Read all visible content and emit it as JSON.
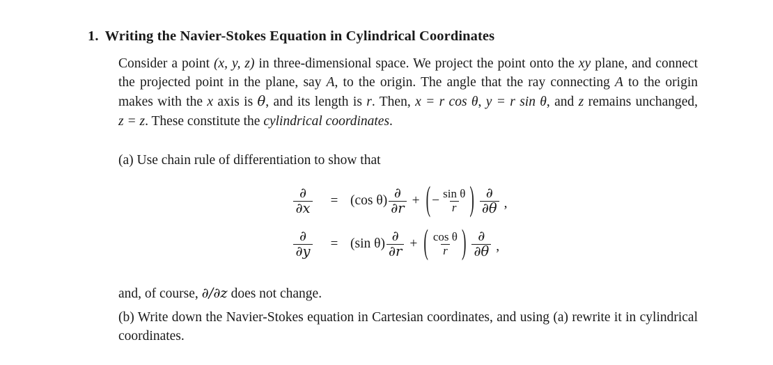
{
  "document": {
    "background_color": "#ffffff",
    "text_color": "#1a1a1a",
    "problem": {
      "number": "1.",
      "title": "Writing the Navier-Stokes Equation in Cylindrical Coordinates"
    },
    "intro_paragraph": {
      "segment_1": "Consider a point ",
      "point_tuple": "(x, y, z)",
      "segment_2": " in three-dimensional space. We project the point onto the ",
      "plane_label": "xy",
      "segment_3": " plane, and connect the projected point in the plane, say ",
      "point_name": "A",
      "segment_4": ", to the origin. The angle that the ray connecting ",
      "point_name_2": "A",
      "segment_5": " to the origin makes with the ",
      "axis_label": "x",
      "segment_6": " axis is ",
      "angle_symbol": "θ",
      "segment_7": ", and its length is ",
      "radius_symbol": "r",
      "segment_8": ". Then, ",
      "relation_x": "x = r cos θ",
      "segment_9": ", ",
      "relation_y": "y = r sin θ",
      "segment_10": ", and ",
      "z_symbol": "z",
      "segment_11": " remains unchanged, ",
      "relation_z": "z = z",
      "segment_12": ". These constitute the ",
      "emphasis": "cylindrical coordinates",
      "segment_13": "."
    },
    "part_a": {
      "label": "(a)",
      "text": "Use chain rule of differentiation to show that"
    },
    "equations": [
      {
        "id": "d-dx",
        "lhs_numerator": "∂",
        "lhs_denominator": "∂x",
        "relation": "=",
        "coefficient": "(cos θ)",
        "term1_numerator": "∂",
        "term1_denominator": "∂r",
        "operator": "+",
        "bracket_sign": "−",
        "bracket_numerator": "sin θ",
        "bracket_denominator": "r",
        "term2_numerator": "∂",
        "term2_denominator": "∂θ",
        "trailing_punctuation": ","
      },
      {
        "id": "d-dy",
        "lhs_numerator": "∂",
        "lhs_denominator": "∂y",
        "relation": "=",
        "coefficient": "(sin θ)",
        "term1_numerator": "∂",
        "term1_denominator": "∂r",
        "operator": "+",
        "bracket_sign": "",
        "bracket_numerator": "cos θ",
        "bracket_denominator": "r",
        "term2_numerator": "∂",
        "term2_denominator": "∂θ",
        "trailing_punctuation": ","
      }
    ],
    "after_equations": {
      "segment_1": "and, of course, ",
      "derivative": "∂/∂z",
      "segment_2": " does not change."
    },
    "part_b": {
      "label": "(b)",
      "text": "Write down the Navier-Stokes equation in Cartesian coordinates, and using (a) rewrite it in cylindrical coordinates."
    }
  }
}
